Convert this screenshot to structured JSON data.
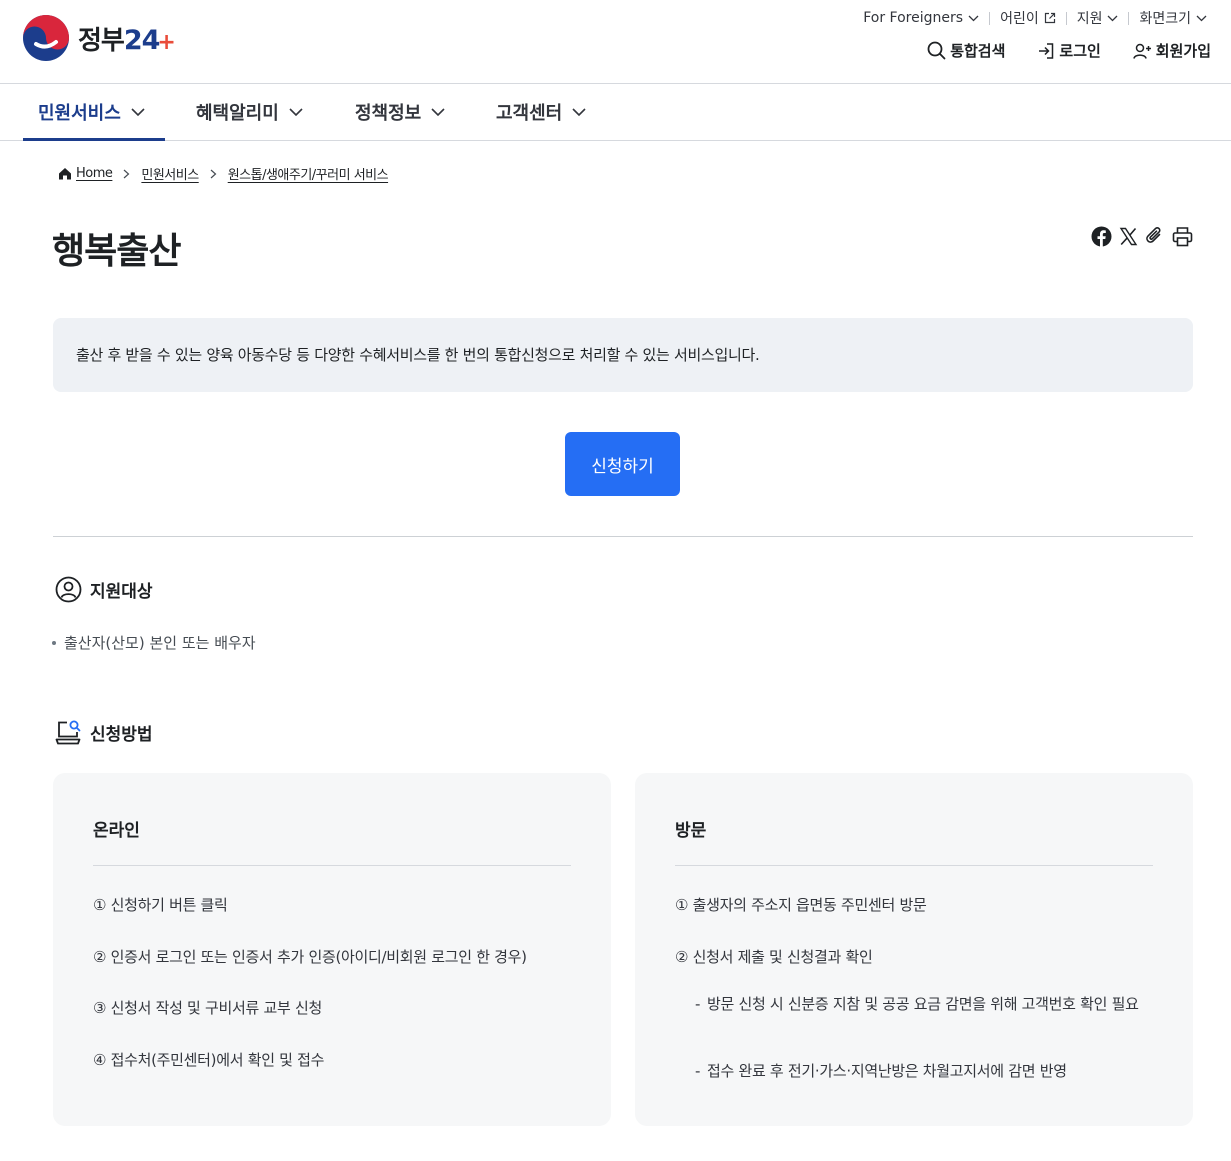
{
  "header": {
    "logo_text": "정부",
    "logo_num": "24",
    "logo_plus": "+",
    "util_links": [
      {
        "label": "For Foreigners",
        "icon": "chevron-down-icon"
      },
      {
        "label": "어린이",
        "icon": "external-link-icon"
      },
      {
        "label": "지원",
        "icon": "chevron-down-icon"
      },
      {
        "label": "화면크기",
        "icon": "chevron-down-icon"
      }
    ],
    "actions": {
      "search": "통합검색",
      "login": "로그인",
      "signup": "회원가입"
    }
  },
  "gnb": {
    "items": [
      {
        "label": "민원서비스",
        "active": true
      },
      {
        "label": "혜택알리미",
        "active": false
      },
      {
        "label": "정책정보",
        "active": false
      },
      {
        "label": "고객센터",
        "active": false
      }
    ]
  },
  "breadcrumb": {
    "home": "Home",
    "items": [
      "민원서비스",
      "원스톱/생애주기/꾸러미 서비스"
    ]
  },
  "page": {
    "title": "행복출산",
    "summary": "출산 후 받을 수 있는 양육 아동수당 등 다양한 수혜서비스를 한 번의 통합신청으로 처리할 수 있는 서비스입니다.",
    "apply_label": "신청하기"
  },
  "share_icons": [
    "facebook-icon",
    "x-icon",
    "link-clip-icon",
    "print-icon"
  ],
  "target_section": {
    "title": "지원대상",
    "items": [
      "출산자(산모) 본인 또는 배우자"
    ]
  },
  "method_section": {
    "title": "신청방법",
    "online": {
      "title": "온라인",
      "steps": [
        "① 신청하기 버튼 클릭",
        "② 인증서 로그인 또는 인증서 추가 인증(아이디/비회원 로그인 한 경우)",
        "③ 신청서 작성 및 구비서류 교부 신청",
        "④ 접수처(주민센터)에서 확인 및 접수"
      ]
    },
    "visit": {
      "title": "방문",
      "steps": [
        "① 출생자의 주소지 읍면동 주민센터 방문",
        "② 신청서 제출 및 신청결과 확인"
      ],
      "notes": [
        "방문 신청 시 신분증 지참 및 공공 요금 감면을 위해 고객번호 확인 필요",
        "접수 완료 후 전기·가스·지역난방은 차월고지서에 감면 반영"
      ]
    }
  },
  "colors": {
    "primary": "#256ef4",
    "navy": "#1c3d8c",
    "summary_bg": "#eef1f5",
    "card_bg": "#f6f7f8"
  }
}
